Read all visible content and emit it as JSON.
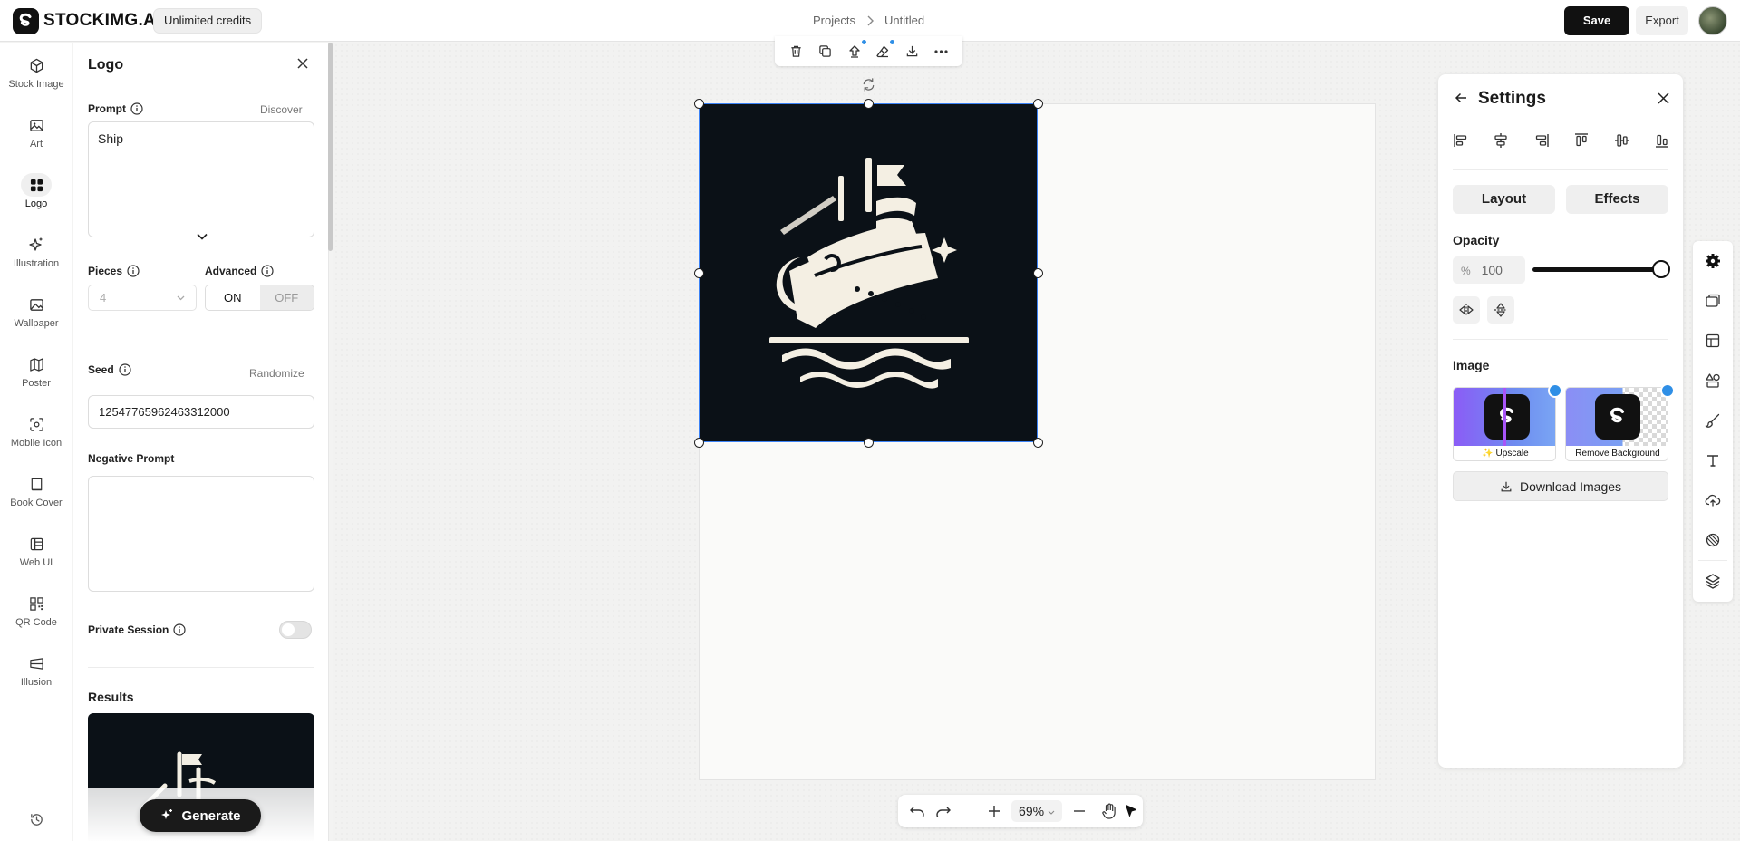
{
  "app": {
    "name": "STOCKIMG.AI",
    "credits_label": "Unlimited credits"
  },
  "breadcrumb": {
    "projects": "Projects",
    "current": "Untitled"
  },
  "header": {
    "save_label": "Save",
    "export_label": "Export"
  },
  "nav": {
    "items": [
      {
        "label": "Stock Image",
        "icon": "cube-icon"
      },
      {
        "label": "Art",
        "icon": "image-icon"
      },
      {
        "label": "Logo",
        "icon": "grid-icon",
        "active": true
      },
      {
        "label": "Illustration",
        "icon": "sparkle-icon"
      },
      {
        "label": "Wallpaper",
        "icon": "landscape-icon"
      },
      {
        "label": "Poster",
        "icon": "map-icon"
      },
      {
        "label": "Mobile Icon",
        "icon": "scan-icon"
      },
      {
        "label": "Book Cover",
        "icon": "book-icon"
      },
      {
        "label": "Web UI",
        "icon": "layout-icon"
      },
      {
        "label": "QR Code",
        "icon": "qr-icon"
      },
      {
        "label": "Illusion",
        "icon": "illusion-icon"
      }
    ],
    "history_icon": "history-icon"
  },
  "panel": {
    "title": "Logo",
    "prompt_label": "Prompt",
    "discover_label": "Discover",
    "prompt_value": "Ship",
    "pieces_label": "Pieces",
    "pieces_value": "4",
    "advanced_label": "Advanced",
    "advanced_on": "ON",
    "advanced_off": "OFF",
    "seed_label": "Seed",
    "randomize_label": "Randomize",
    "seed_value": "12547765962463312000",
    "negative_label": "Negative Prompt",
    "negative_value": "",
    "private_label": "Private Session",
    "private_enabled": false,
    "results_label": "Results",
    "generate_label": "Generate"
  },
  "canvas": {
    "zoom": "69%",
    "toolbar_icons": [
      "trash-icon",
      "duplicate-icon",
      "upscale-icon",
      "eraser-icon",
      "download-icon",
      "more-icon"
    ]
  },
  "settings": {
    "title": "Settings",
    "layout_tab": "Layout",
    "effects_tab": "Effects",
    "opacity_label": "Opacity",
    "opacity_unit": "%",
    "opacity_value": "100",
    "opacity_level": 1.0,
    "image_label": "Image",
    "upscale_label": "✨ Upscale",
    "remove_bg_label": "Remove Background",
    "download_label": "Download Images"
  },
  "colors": {
    "accent": "#2f8fe6",
    "dark": "#111111",
    "canvas": "#f2f2f1"
  }
}
